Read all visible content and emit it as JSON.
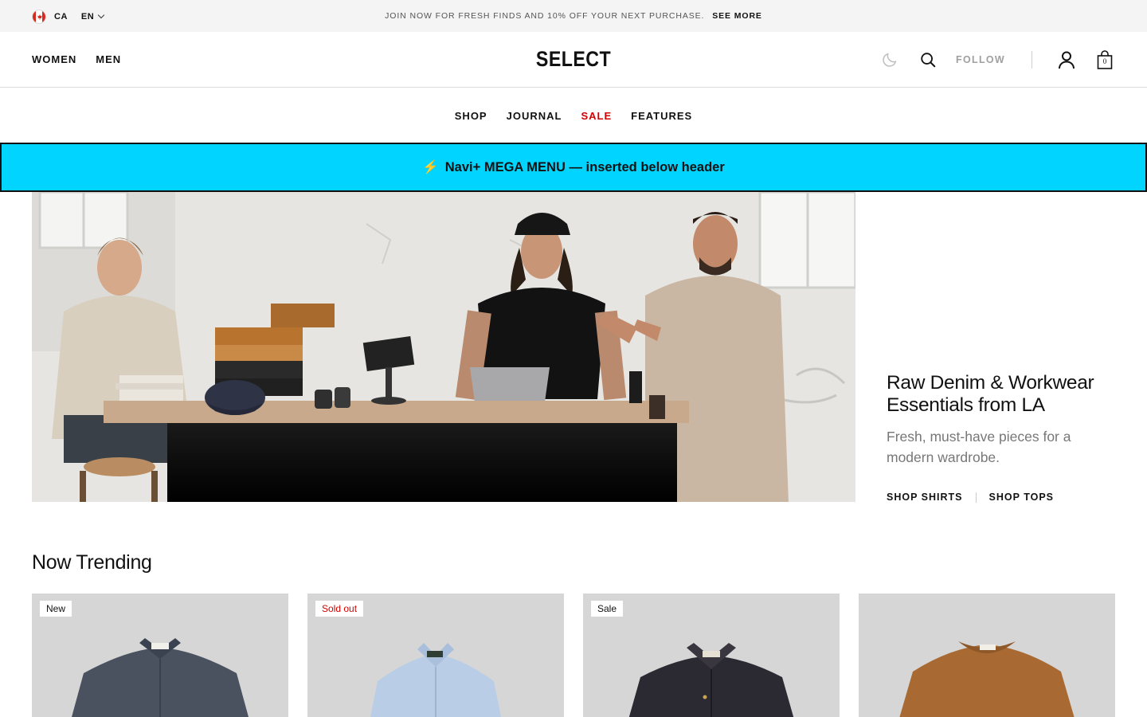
{
  "announcement": {
    "country": "CA",
    "language": "EN",
    "message": "JOIN NOW FOR FRESH FINDS AND 10% OFF YOUR NEXT PURCHASE.",
    "cta": "SEE MORE"
  },
  "header": {
    "gender_nav": [
      "WOMEN",
      "MEN"
    ],
    "logo": "SELECT",
    "follow_label": "FOLLOW",
    "cart_count": "0",
    "icons": [
      "moon-icon",
      "search-icon",
      "user-icon",
      "bag-icon"
    ]
  },
  "subnav": {
    "items": [
      "SHOP",
      "JOURNAL",
      "SALE",
      "FEATURES"
    ],
    "sale_color": "#d10000"
  },
  "mega_menu": {
    "icon": "⚡",
    "text": "Navi+ MEGA MENU — inserted below header",
    "background": "#00d4ff"
  },
  "hero": {
    "title": "Raw Denim & Workwear Essentials from LA",
    "subtitle": "Fresh, must-have pieces for a modern wardrobe.",
    "links": [
      "SHOP SHIRTS",
      "SHOP TOPS"
    ]
  },
  "trending": {
    "title": "Now Trending",
    "products": [
      {
        "badge": "New",
        "badge_style": "default",
        "item": "denim-shirt",
        "color": "#4a5260"
      },
      {
        "badge": "Sold out",
        "badge_style": "red",
        "item": "oxford-shirt",
        "color": "#b9cde6"
      },
      {
        "badge": "Sale",
        "badge_style": "default",
        "item": "chore-jacket",
        "color": "#2b2a33"
      },
      {
        "badge": "",
        "badge_style": "none",
        "item": "knit-sweater",
        "color": "#a86a32"
      }
    ]
  }
}
